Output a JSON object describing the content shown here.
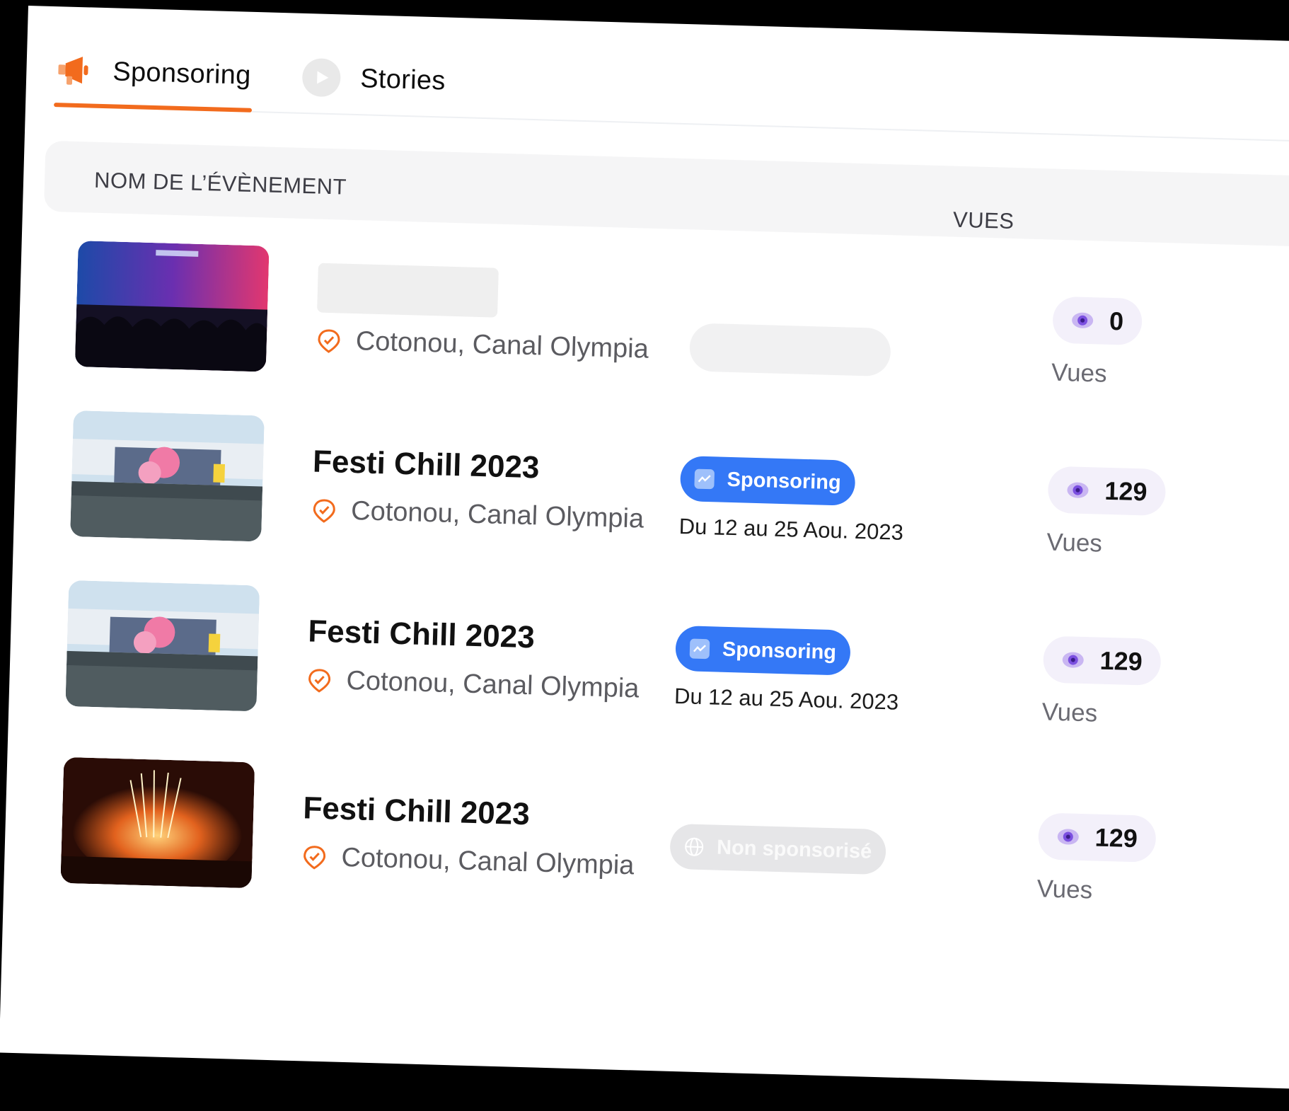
{
  "tabs": [
    {
      "label": "Sponsoring",
      "icon": "megaphone-icon",
      "active": true
    },
    {
      "label": "Stories",
      "icon": "play-circle-icon",
      "active": false
    }
  ],
  "colors": {
    "accent": "#f26b1d",
    "badge_blue": "#3478f6",
    "eye_purple": "#7b4fe0"
  },
  "table": {
    "headers": {
      "name": "NOM DE L’ÉVÈNEMENT",
      "views": "VUES"
    },
    "rows": [
      {
        "title": "",
        "location": "Cotonou, Canal Olympia",
        "status": "",
        "dates": "",
        "views": "0",
        "views_label": "Vues",
        "image": "concert-stage-photo"
      },
      {
        "title": "Festi Chill 2023",
        "location": "Cotonou, Canal Olympia",
        "status": "Sponsoring",
        "dates": "Du 12 au 25 Aou. 2023",
        "views": "129",
        "views_label": "Vues",
        "image": "festival-crowd-photo"
      },
      {
        "title": "Festi Chill 2023",
        "location": "Cotonou, Canal Olympia",
        "status": "Sponsoring",
        "dates": "Du 12 au 25 Aou. 2023",
        "views": "129",
        "views_label": "Vues",
        "image": "festival-crowd-photo"
      },
      {
        "title": "Festi Chill 2023",
        "location": "Cotonou, Canal Olympia",
        "status": "Non sponsorisé",
        "dates": "",
        "views": "129",
        "views_label": "Vues",
        "image": "fireworks-stage-photo"
      }
    ]
  }
}
